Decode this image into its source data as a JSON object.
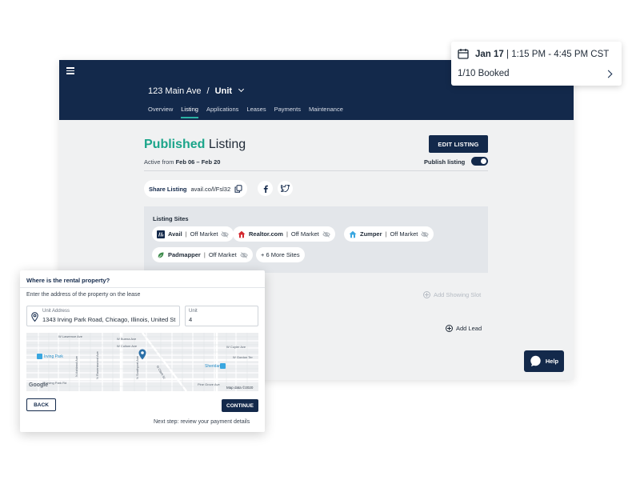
{
  "header": {
    "address": "123 Main Ave",
    "separator": "/",
    "unit": "Unit",
    "tabs": [
      "Overview",
      "Listing",
      "Applications",
      "Leases",
      "Payments",
      "Maintenance"
    ],
    "active_tab": "Listing"
  },
  "listing": {
    "title_status": "Published",
    "title_rest": " Listing",
    "edit_button": "EDIT LISTING",
    "active_prefix": "Active from ",
    "active_range": "Feb 06 – Feb 20",
    "publish_label": "Publish listing",
    "publish_on": true,
    "share_label": "Share Listing",
    "share_url": "avail.co/l/Fsl32"
  },
  "sites": {
    "title": "Listing Sites",
    "items": [
      {
        "name": "Avail",
        "status": "Off Market"
      },
      {
        "name": "Realtor.com",
        "status": "Off Market"
      },
      {
        "name": "Zumper",
        "status": "Off Market"
      },
      {
        "name": "Padmapper",
        "status": "Off Market"
      }
    ],
    "more": "+ 6 More Sites",
    "separator": "|"
  },
  "actions": {
    "add_showing": "Add Showing Slot",
    "add_lead": "Add Lead",
    "help": "Help"
  },
  "booking": {
    "date": "Jan 17",
    "time": "| 1:15 PM - 4:45 PM CST",
    "booked": "1/10 Booked"
  },
  "dialog": {
    "title": "Where is the rental property?",
    "subtitle": "Enter the address of the property on the lease",
    "address_label": "Unit Address",
    "address_value": "1343 Irving Park Road, Chicago, Illinois, United St",
    "unit_label": "Unit",
    "unit_value": "4",
    "map": {
      "labels": [
        "W Buena Ave",
        "W Cullom Ave",
        "W Cuyler Ave",
        "Irving Park",
        "Sheridan",
        "W Gordon Ter",
        "Pine Grove Ave",
        "N Ashland Ave",
        "N Southport Ave",
        "N Clark St",
        "W Lawrence Ave",
        "N Ravenswood Ave",
        "W Irving Park Rd"
      ],
      "attribution": "Map data ©2020",
      "provider": "Google"
    },
    "back": "BACK",
    "continue": "CONTINUE",
    "next_step": "Next step: review your payment details"
  },
  "colors": {
    "navy": "#13294b",
    "teal": "#1ba58a",
    "marker": "#2a6fa8"
  }
}
